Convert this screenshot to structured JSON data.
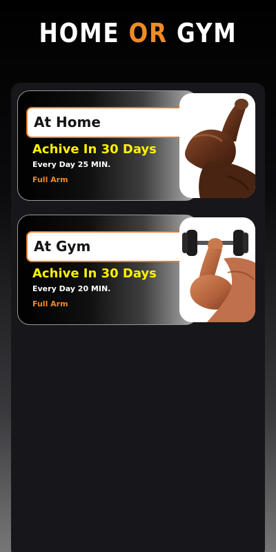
{
  "header": {
    "title_part1": "HOME",
    "title_accent": "OR",
    "title_part2": "GYM",
    "accent_color": "#f08a24"
  },
  "workouts": [
    {
      "label": "At Home",
      "headline": "Achive In 30 Days",
      "duration": "Every Day 25 MIN.",
      "target": "Full Arm",
      "image": "flexed-arm-icon"
    },
    {
      "label": "At Gym",
      "headline": "Achive In 30 Days",
      "duration": "Every Day 20 MIN.",
      "target": "Full Arm",
      "image": "dumbbell-arm-icon"
    }
  ],
  "colors": {
    "headline": "#fff200",
    "label_border": "#e8781f",
    "panel": "#17161b"
  }
}
